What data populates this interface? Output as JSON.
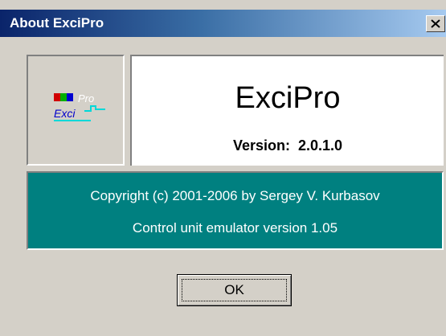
{
  "window": {
    "title": "About ExciPro",
    "close_symbol": "✕"
  },
  "logo": {
    "text_exci": "Exci",
    "text_pro": "Pro"
  },
  "product": {
    "name": "ExciPro",
    "version_line": "Version:  2.0.1.0"
  },
  "info": {
    "copyright": "Copyright (c) 2001-2006 by Sergey V. Kurbasov",
    "emulator": "Control unit emulator version 1.05"
  },
  "buttons": {
    "ok_label": "OK"
  },
  "colors": {
    "titlebar_start": "#0a246a",
    "titlebar_end": "#a6caf0",
    "panel_teal": "#008080",
    "dialog_face": "#d4d0c8"
  }
}
